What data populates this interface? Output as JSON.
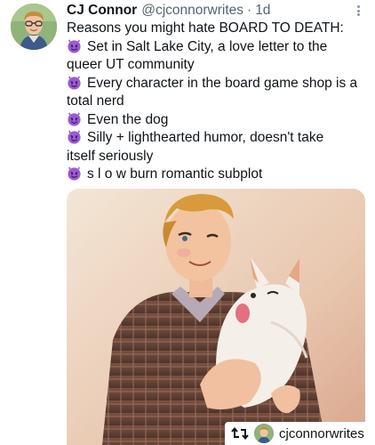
{
  "tweet": {
    "display_name": "CJ Connor",
    "handle": "@cjconnorwrites",
    "separator": "·",
    "time": "1d",
    "lines": [
      {
        "text": "Reasons you might hate BOARD TO DEATH:",
        "emoji": false
      },
      {
        "text": "Set in Salt Lake City, a love letter to the",
        "emoji": true
      },
      {
        "text": "queer UT community",
        "emoji": false
      },
      {
        "text": "Every character in the board game shop is a",
        "emoji": true
      },
      {
        "text": "total nerd",
        "emoji": false
      },
      {
        "text": "Even the dog",
        "emoji": true
      },
      {
        "text": "Silly + lighthearted humor, doesn't take",
        "emoji": true
      },
      {
        "text": "itself seriously",
        "emoji": false
      },
      {
        "text": "s l o w burn romantic subplot",
        "emoji": true
      }
    ],
    "emoji_icon": "smiling-devil-emoji",
    "more_icon": "more-options-icon"
  },
  "repost_badge": {
    "icon": "repost-icon",
    "username": "cjconnorwrites"
  },
  "colors": {
    "text": "#0f1419",
    "secondary": "#536471",
    "emoji_purple": "#9b5bd3"
  }
}
